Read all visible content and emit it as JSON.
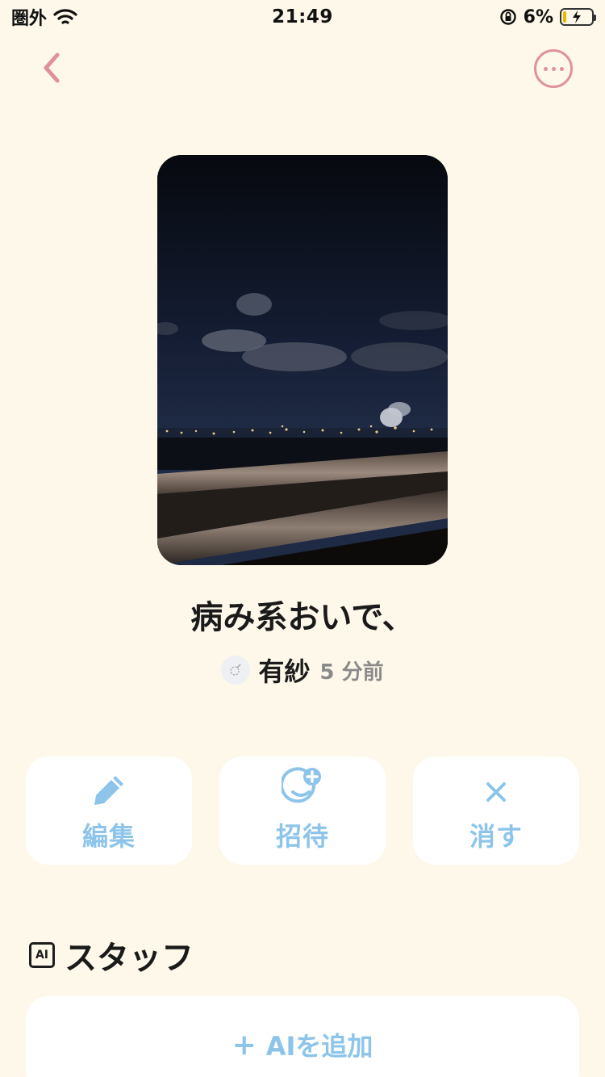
{
  "status_bar": {
    "carrier": "圏外",
    "time": "21:49",
    "battery": "6%"
  },
  "post": {
    "title": "病み系おいで、",
    "author": "有紗",
    "time_ago": "5 分前"
  },
  "actions": {
    "edit_label": "編集",
    "invite_label": "招待",
    "delete_label": "消す"
  },
  "staff": {
    "badge": "AI",
    "title": "スタッフ",
    "add_label": "AIを追加",
    "add_prefix": "+"
  },
  "colors": {
    "background": "#fdf8e9",
    "accent_pink": "#e0929a",
    "accent_blue": "#8cc4ea"
  },
  "icons": {
    "back": "chevron-left-icon",
    "more": "more-horizontal-icon",
    "edit": "pencil-icon",
    "invite": "add-face-icon",
    "delete": "close-icon"
  }
}
